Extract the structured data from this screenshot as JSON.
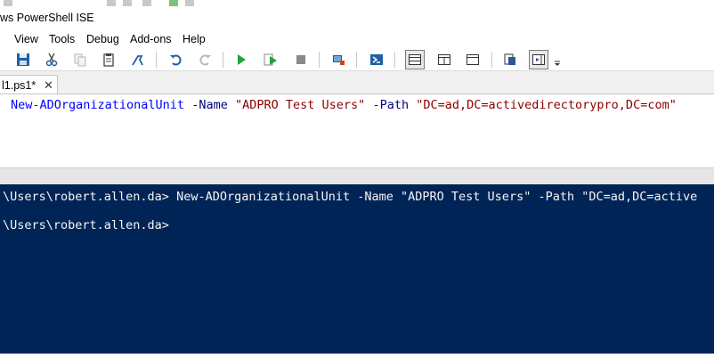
{
  "window": {
    "title": "ws PowerShell ISE"
  },
  "menu": {
    "items": [
      {
        "label": "View"
      },
      {
        "label": "Tools"
      },
      {
        "label": "Debug"
      },
      {
        "label": "Add-ons"
      },
      {
        "label": "Help"
      }
    ]
  },
  "toolbar": {
    "icons": [
      "save-icon",
      "cut-icon",
      "copy-icon",
      "paste-icon",
      "clear-console-icon",
      "undo-icon",
      "redo-icon",
      "run-script-icon",
      "run-selection-icon",
      "stop-icon",
      "remote-powershell-icon",
      "powershell-console-icon",
      "show-script-pane-top-icon",
      "show-script-pane-right-icon",
      "show-script-pane-maximized-icon",
      "show-commands-window-icon",
      "show-command-addon-icon",
      "toolbar-overflow-icon"
    ]
  },
  "tabs": [
    {
      "label": "l1.ps1*",
      "close": "✕"
    }
  ],
  "editor": {
    "cmdlet": "New-ADOrganizationalUnit",
    "param1": "-Name",
    "value1": "\"ADPRO Test Users\"",
    "param2": "-Path",
    "value2": "\"DC=ad,DC=activedirectorypro,DC=com\""
  },
  "console": {
    "line1": "\\Users\\robert.allen.da> New-ADOrganizationalUnit -Name \"ADPRO Test Users\" -Path \"DC=ad,DC=active",
    "line2": "\\Users\\robert.allen.da>"
  },
  "colors": {
    "console_bg": "#012456",
    "console_text": "#f5f5f5",
    "cmdlet": "#0000ff",
    "parameter": "#000080",
    "string": "#8b0000"
  }
}
